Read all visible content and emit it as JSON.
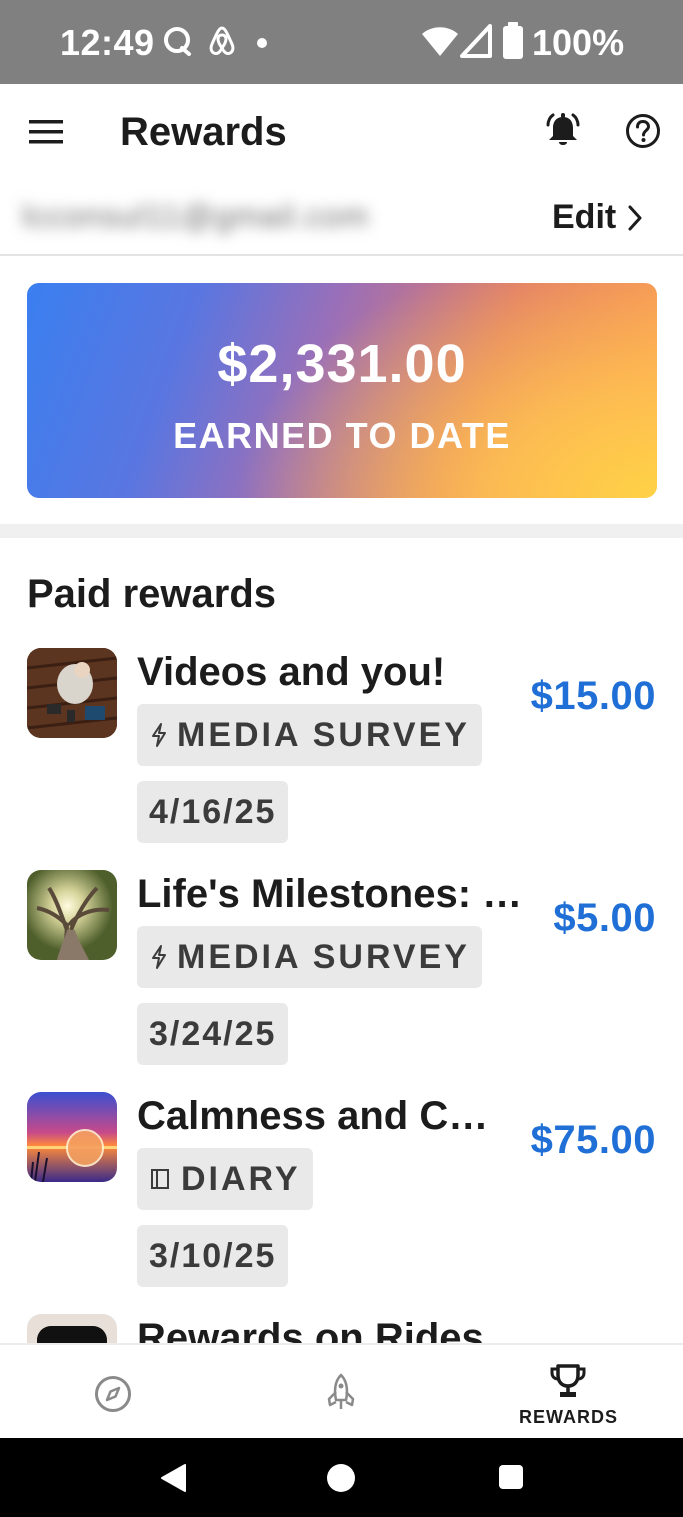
{
  "status_bar": {
    "time": "12:49",
    "battery": "100%",
    "icons": [
      "chat-icon",
      "airbnb-icon",
      "dot-icon",
      "wifi-icon",
      "signal-icon",
      "battery-icon"
    ]
  },
  "header": {
    "title": "Rewards",
    "icons": [
      "menu-icon",
      "bell-icon",
      "help-icon"
    ]
  },
  "account": {
    "email": "lcconsul11@gmail.com",
    "edit_label": "Edit"
  },
  "earnings": {
    "amount": "$2,331.00",
    "label": "EARNED TO DATE"
  },
  "paid_rewards": {
    "title": "Paid rewards",
    "items": [
      {
        "title": "Videos and you!",
        "type": "MEDIA SURVEY",
        "type_icon": "lightning-icon",
        "date": "4/16/25",
        "amount": "$15.00"
      },
      {
        "title": "Life's Milestones: …",
        "type": "MEDIA SURVEY",
        "type_icon": "lightning-icon",
        "date": "3/24/25",
        "amount": "$5.00"
      },
      {
        "title": "Calmness and C…",
        "type": "DIARY",
        "type_icon": "diary-icon",
        "date": "3/10/25",
        "amount": "$75.00"
      },
      {
        "title": "Rewards on Rides",
        "amount": "$"
      }
    ]
  },
  "bottom_nav": {
    "items": [
      {
        "icon": "compass-icon",
        "label": ""
      },
      {
        "icon": "rocket-icon",
        "label": ""
      },
      {
        "icon": "trophy-icon",
        "label": "REWARDS"
      }
    ]
  },
  "colors": {
    "accent_blue": "#1f6fd6",
    "status_bar": "#808080",
    "chip_bg": "#e9e9e9"
  }
}
